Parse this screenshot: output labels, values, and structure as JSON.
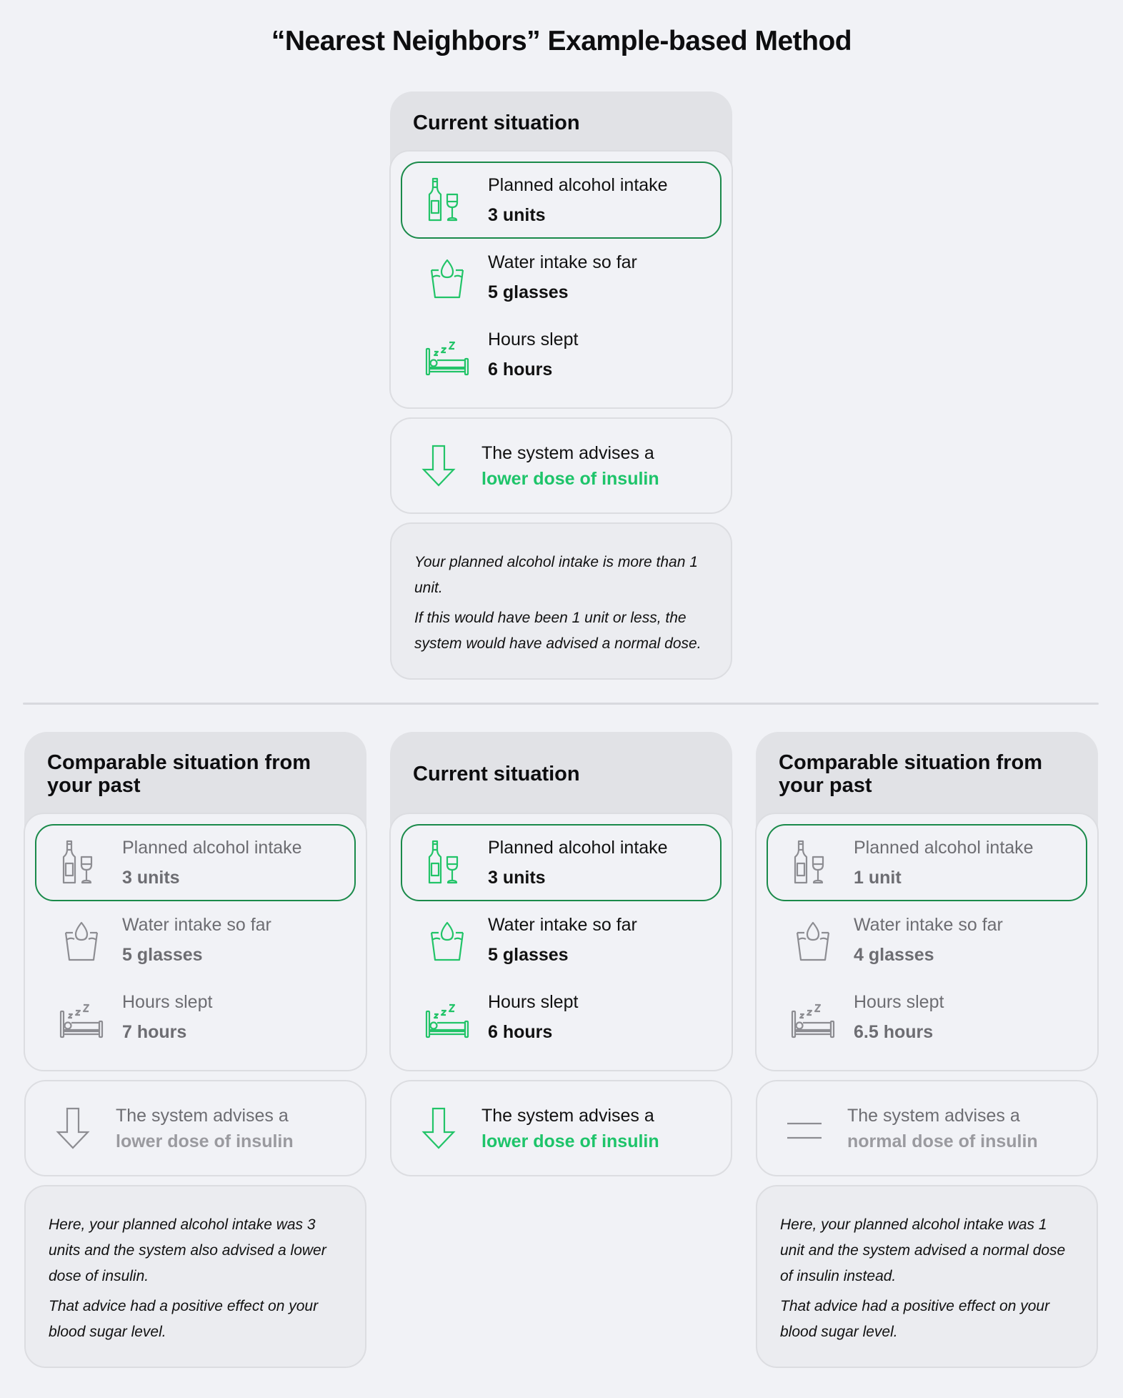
{
  "title": "“Nearest Neighbors” Example-based Method",
  "colors": {
    "accent_green": "#1ec46a",
    "highlight_border": "#1a8a4a",
    "muted_text": "#6d6d72",
    "muted_advice": "#9a9a9f",
    "background": "#f1f2f6"
  },
  "top": {
    "card": {
      "heading": "Current situation",
      "rows": [
        {
          "icon": "wine-bottle-glass-icon",
          "label": "Planned alcohol intake",
          "value": "3 units",
          "highlighted": true
        },
        {
          "icon": "water-glass-icon",
          "label": "Water intake so far",
          "value": "5 glasses",
          "highlighted": false
        },
        {
          "icon": "bed-sleep-icon",
          "label": "Hours slept",
          "value": "6 hours",
          "highlighted": false
        }
      ]
    },
    "advice": {
      "icon": "arrow-down-icon",
      "prefix": "The system advises a",
      "dose": "lower dose of insulin"
    },
    "info": [
      "Your planned alcohol intake is more than 1 unit.",
      "If this would have been 1 unit or less, the system would have advised a normal dose."
    ]
  },
  "bottom": {
    "left": {
      "heading": "Comparable situation from your past",
      "rows": [
        {
          "icon": "wine-bottle-glass-icon",
          "label": "Planned alcohol intake",
          "value": "3 units",
          "highlighted": true
        },
        {
          "icon": "water-glass-icon",
          "label": "Water intake so far",
          "value": "5 glasses",
          "highlighted": false
        },
        {
          "icon": "bed-sleep-icon",
          "label": "Hours slept",
          "value": "7 hours",
          "highlighted": false
        }
      ],
      "advice": {
        "icon": "arrow-down-icon",
        "prefix": "The system advises a",
        "dose": "lower dose of insulin"
      },
      "info": [
        "Here, your planned alcohol intake was 3 units and the system also advised a lower dose of insulin.",
        "That advice had a positive effect on your blood sugar level."
      ]
    },
    "middle": {
      "heading": "Current situation",
      "rows": [
        {
          "icon": "wine-bottle-glass-icon",
          "label": "Planned alcohol intake",
          "value": "3 units",
          "highlighted": true
        },
        {
          "icon": "water-glass-icon",
          "label": "Water intake so far",
          "value": "5 glasses",
          "highlighted": false
        },
        {
          "icon": "bed-sleep-icon",
          "label": "Hours slept",
          "value": "6 hours",
          "highlighted": false
        }
      ],
      "advice": {
        "icon": "arrow-down-icon",
        "prefix": "The system advises a",
        "dose": "lower dose of insulin"
      }
    },
    "right": {
      "heading": "Comparable situation from your past",
      "rows": [
        {
          "icon": "wine-bottle-glass-icon",
          "label": "Planned alcohol intake",
          "value": "1 unit",
          "highlighted": true
        },
        {
          "icon": "water-glass-icon",
          "label": "Water intake so far",
          "value": "4 glasses",
          "highlighted": false
        },
        {
          "icon": "bed-sleep-icon",
          "label": "Hours slept",
          "value": "6.5 hours",
          "highlighted": false
        }
      ],
      "advice": {
        "icon": "equals-icon",
        "prefix": "The system advises a",
        "dose": "normal dose of insulin"
      },
      "info": [
        "Here, your planned alcohol intake was 1 unit and the system advised a normal dose of insulin instead.",
        "That advice had a positive effect on your blood sugar level."
      ]
    }
  }
}
